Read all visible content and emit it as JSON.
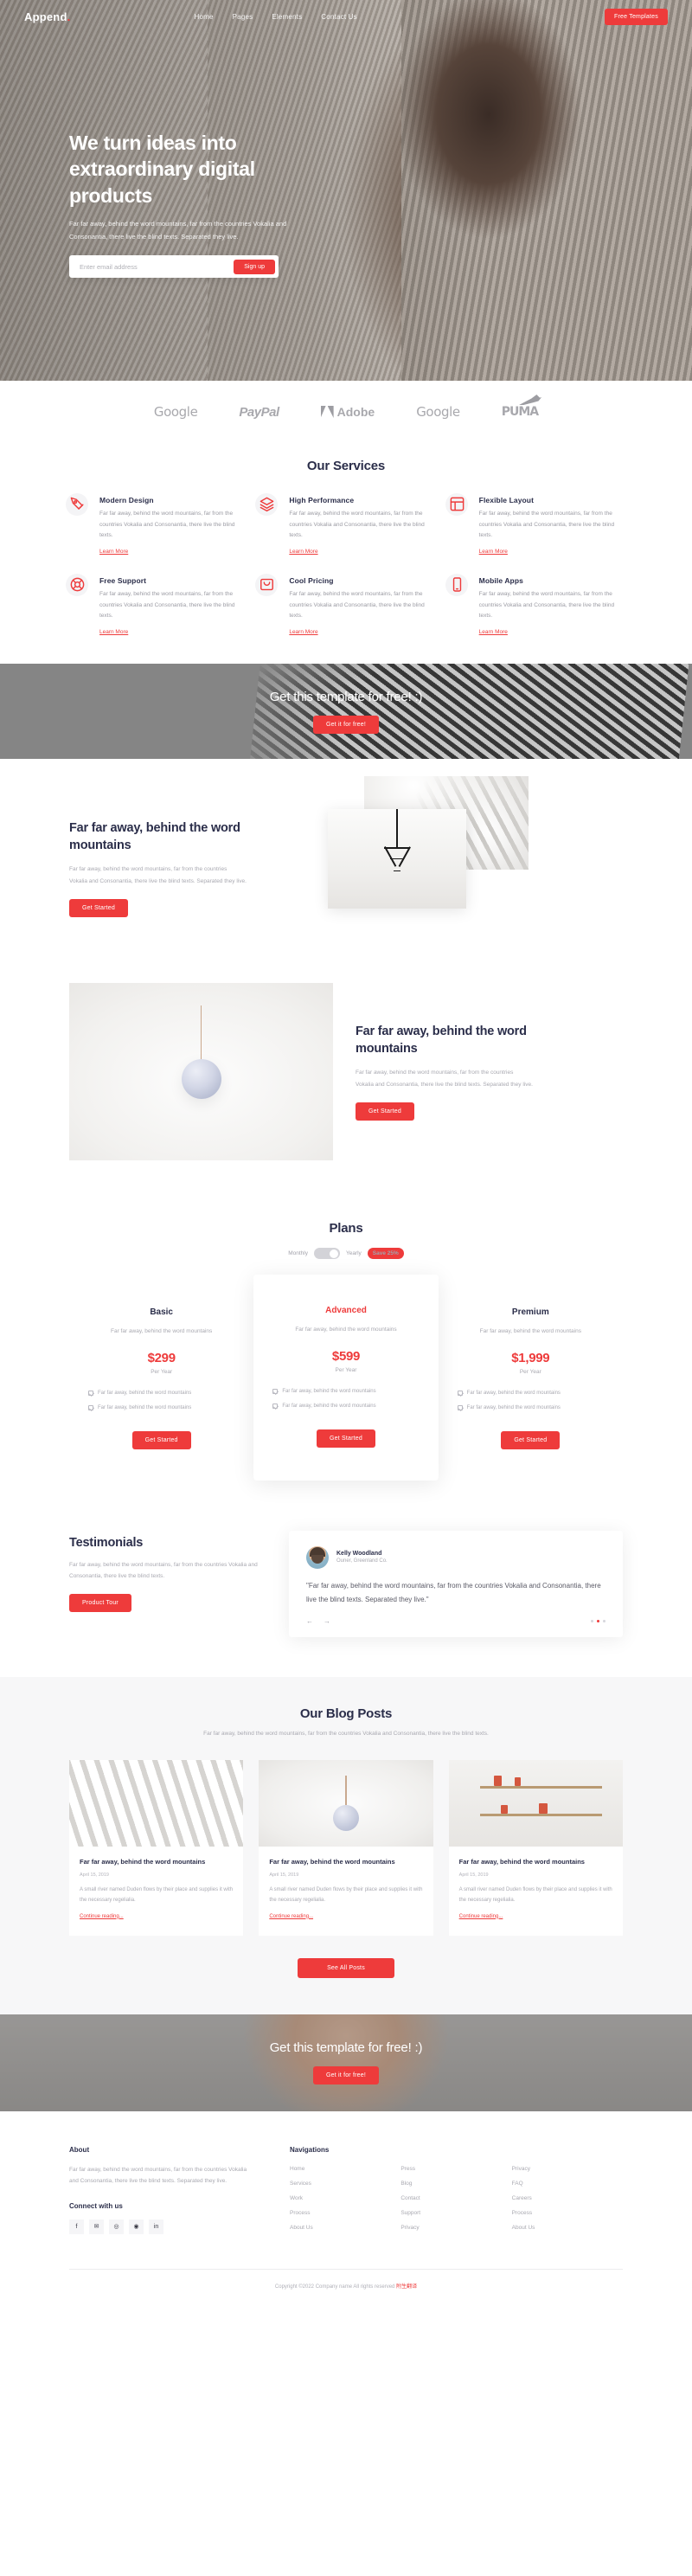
{
  "header": {
    "logo": "Append",
    "logo_dot": ".",
    "nav": [
      {
        "label": "Home"
      },
      {
        "label": "Pages"
      },
      {
        "label": "Elements"
      },
      {
        "label": "Contact Us"
      }
    ],
    "cta": "Free Templates"
  },
  "hero": {
    "title": "We turn ideas into extraordinary digital products",
    "paragraph": "Far far away, behind the word mountains, far from the countries Vokalia and Consonantia, there live the blind texts. Separated they live.",
    "email_placeholder": "Enter email address",
    "signup_button": "Sign up"
  },
  "brands": [
    {
      "name": "Google"
    },
    {
      "name": "PayPal"
    },
    {
      "name": "Adobe"
    },
    {
      "name": "Google"
    },
    {
      "name": "PUMA"
    }
  ],
  "services": {
    "title": "Our Services",
    "learn_more": "Learn More",
    "body": "Far far away, behind the word mountains, far from the countries Vokalia and Consonantia, there live the blind texts.",
    "items": [
      {
        "icon": "pen-nib-icon",
        "title": "Modern Design"
      },
      {
        "icon": "layers-icon",
        "title": "High Performance"
      },
      {
        "icon": "layout-icon",
        "title": "Flexible Layout"
      },
      {
        "icon": "lifebuoy-icon",
        "title": "Free Support"
      },
      {
        "icon": "shopping-bag-icon",
        "title": "Cool Pricing"
      },
      {
        "icon": "mobile-icon",
        "title": "Mobile Apps"
      }
    ]
  },
  "cta_banner": {
    "title": "Get this template for free! :)",
    "button": "Get it for free!"
  },
  "feature_one": {
    "title": "Far far away, behind the word mountains",
    "paragraph": "Far far away, behind the word mountains, far from the countries Vokalia and Consonantia, there live the blind texts. Separated they live.",
    "button": "Get Started"
  },
  "feature_two": {
    "title": "Far far away, behind the word mountains",
    "paragraph": "Far far away, behind the word mountains, far from the countries Vokalia and Consonantia, there live the blind texts. Separated they live.",
    "button": "Get Started"
  },
  "plans": {
    "title": "Plans",
    "toggle_monthly": "Monthly",
    "toggle_yearly": "Yearly",
    "save_badge": "Save 25%",
    "items": [
      {
        "name": "Basic",
        "desc": "Far far away, behind the word mountains",
        "price": "$299",
        "period": "Per Year",
        "features": [
          "Far far away, behind the word mountains",
          "Far far away, behind the word mountains"
        ],
        "button": "Get Started",
        "featured": false
      },
      {
        "name": "Advanced",
        "desc": "Far far away, behind the word mountains",
        "price": "$599",
        "period": "Per Year",
        "features": [
          "Far far away, behind the word mountains",
          "Far far away, behind the word mountains"
        ],
        "button": "Get Started",
        "featured": true
      },
      {
        "name": "Premium",
        "desc": "Far far away, behind the word mountains",
        "price": "$1,999",
        "period": "Per Year",
        "features": [
          "Far far away, behind the word mountains",
          "Far far away, behind the word mountains"
        ],
        "button": "Get Started",
        "featured": false
      }
    ]
  },
  "testimonials": {
    "title": "Testimonials",
    "paragraph": "Far far away, behind the word mountains, far from the countries Vokalia and Consonantia, there live the blind texts.",
    "button": "Product Tour",
    "author_name": "Kelly Woodland",
    "author_role": "Ouner, Greenland Co.",
    "quote": "\"Far far away, behind the word mountains, far from the countries Vokalia and Consonantia, there live the blind texts. Separated they live.\"",
    "prev_icon": "arrow-left-icon",
    "next_icon": "arrow-right-icon",
    "dots": 3,
    "active_dot": 2
  },
  "blog": {
    "title": "Our Blog Posts",
    "subtitle": "Far far away, behind the word mountains, far from the countries Vokalia and Consonantia, there live the blind texts.",
    "see_all": "See All Posts",
    "continue": "Continue reading...",
    "posts": [
      {
        "title": "Far far away, behind the word mountains",
        "date": "April 15, 2019",
        "excerpt": "A small river named Duden flows by their place and supplies it with the necessary regelialia."
      },
      {
        "title": "Far far away, behind the word mountains",
        "date": "April 15, 2019",
        "excerpt": "A small river named Duden flows by their place and supplies it with the necessary regelialia."
      },
      {
        "title": "Far far away, behind the word mountains",
        "date": "April 15, 2019",
        "excerpt": "A small river named Duden flows by their place and supplies it with the necessary regelialia."
      }
    ]
  },
  "cta_banner_2": {
    "title": "Get this template for free! :)",
    "button": "Get it for free!"
  },
  "footer": {
    "about_heading": "About",
    "about_text": "Far far away, behind the word mountains, far from the countries Vokalia and Consonantia, there live the blind texts. Separated they live.",
    "connect_heading": "Connect with us",
    "socials": [
      {
        "icon": "facebook-icon",
        "glyph": "f"
      },
      {
        "icon": "twitter-icon",
        "glyph": "✉"
      },
      {
        "icon": "instagram-icon",
        "glyph": "◎"
      },
      {
        "icon": "dribbble-icon",
        "glyph": "◉"
      },
      {
        "icon": "linkedin-icon",
        "glyph": "in"
      }
    ],
    "nav_heading": "Navigations",
    "nav_cols": [
      [
        "Home",
        "Services",
        "Work",
        "Process",
        "About Us"
      ],
      [
        "Press",
        "Blog",
        "Contact",
        "Support",
        "Privacy"
      ],
      [
        "Privacy",
        "FAQ",
        "Careers",
        "Process",
        "About Us"
      ]
    ],
    "copyright": "Copyright ©2022 Company name All rights reserved",
    "copyright_suffix": "附生翻译"
  },
  "colors": {
    "accent": "#ee3b3b",
    "dark": "#2b2e4a",
    "muted": "#a9a9b1"
  }
}
